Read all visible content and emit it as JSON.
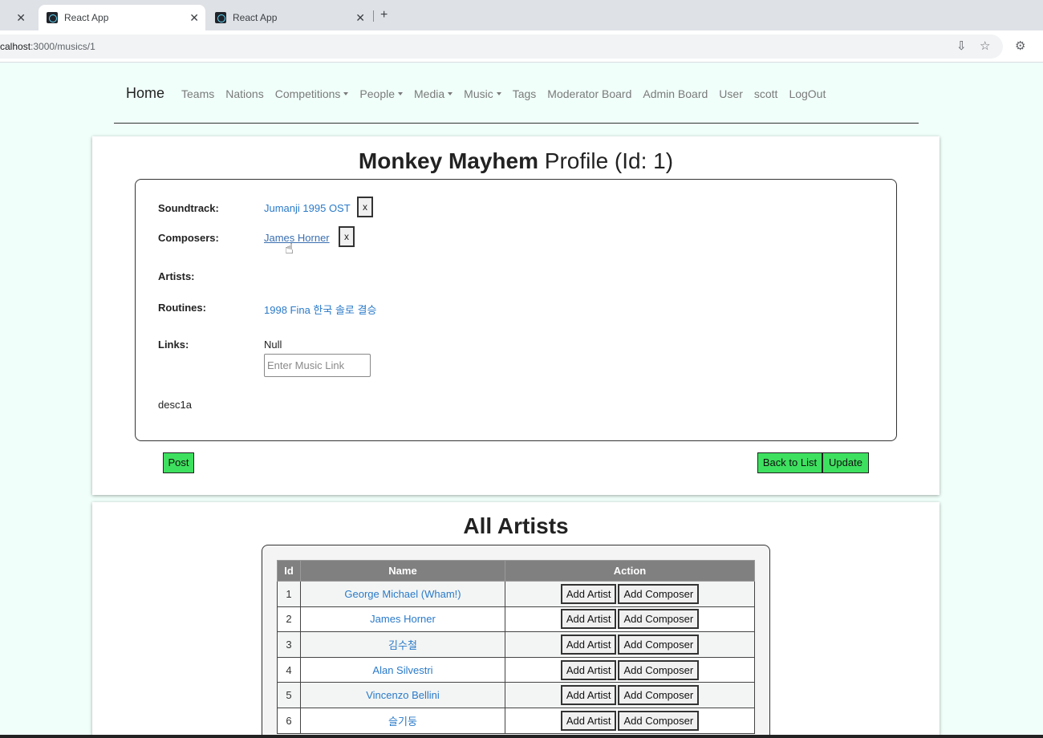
{
  "browser": {
    "tabs": [
      {
        "title": ""
      },
      {
        "title": "React App"
      },
      {
        "title": "React App"
      }
    ],
    "url_host": "calhost",
    "url_rest": ":3000/musics/1"
  },
  "nav": {
    "brand": "Home",
    "links": [
      "Teams",
      "Nations",
      "Competitions",
      "People",
      "Media",
      "Music",
      "Tags",
      "Moderator Board",
      "Admin Board",
      "User",
      "scott",
      "LogOut"
    ]
  },
  "profile": {
    "title_bold": "Monkey Mayhem",
    "title_rest": " Profile (Id: 1)",
    "soundtrack_label": "Soundtrack:",
    "soundtrack_value": "Jumanji 1995 OST",
    "composers_label": "Composers:",
    "composers_value": "James Horner",
    "artists_label": "Artists:",
    "routines_label": "Routines:",
    "routines_value": "1998 Fina 한국 솔로 결승",
    "links_label": "Links:",
    "links_value": "Null",
    "link_placeholder": "Enter Music Link",
    "description": "desc1a",
    "remove_label": "x",
    "post_label": "Post",
    "back_label": "Back to List",
    "update_label": "Update"
  },
  "artists": {
    "title": "All Artists",
    "columns": [
      "Id",
      "Name",
      "Action"
    ],
    "add_artist_label": "Add Artist",
    "add_composer_label": "Add Composer",
    "rows": [
      {
        "id": "1",
        "name": "George Michael (Wham!)"
      },
      {
        "id": "2",
        "name": "James Horner"
      },
      {
        "id": "3",
        "name": "김수철"
      },
      {
        "id": "4",
        "name": "Alan Silvestri"
      },
      {
        "id": "5",
        "name": "Vincenzo Bellini"
      },
      {
        "id": "6",
        "name": "슬기둥"
      }
    ]
  }
}
